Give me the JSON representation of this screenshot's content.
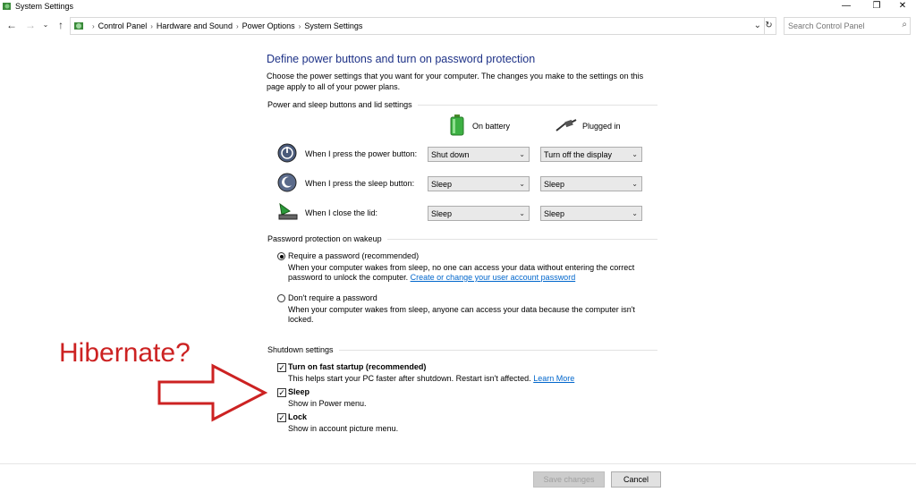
{
  "window": {
    "title": "System Settings",
    "minimize_glyph": "—",
    "restore_glyph": "❐",
    "close_glyph": "✕"
  },
  "nav": {
    "back_glyph": "←",
    "forward_glyph": "→",
    "up_glyph": "↑",
    "breadcrumbs": [
      "Control Panel",
      "Hardware and Sound",
      "Power Options",
      "System Settings"
    ],
    "dropdown_glyph": "⌄",
    "refresh_glyph": "↻",
    "search_placeholder": "Search Control Panel",
    "search_icon_glyph": "⌕"
  },
  "page": {
    "heading": "Define power buttons and turn on password protection",
    "intro": "Choose the power settings that you want for your computer. The changes you make to the settings on this page apply to all of your power plans."
  },
  "power_section": {
    "label": "Power and sleep buttons and lid settings",
    "col_battery": "On battery",
    "col_plugged": "Plugged in",
    "rows": [
      {
        "label": "When I press the power button:",
        "battery": "Shut down",
        "plugged": "Turn off the display"
      },
      {
        "label": "When I press the sleep button:",
        "battery": "Sleep",
        "plugged": "Sleep"
      },
      {
        "label": "When I close the lid:",
        "battery": "Sleep",
        "plugged": "Sleep"
      }
    ],
    "arrow_glyph": "⌄"
  },
  "password_section": {
    "label": "Password protection on wakeup",
    "require_label": "Require a password (recommended)",
    "require_desc_1": "When your computer wakes from sleep, no one can access your data without entering the correct",
    "require_desc_2": "password to unlock the computer.",
    "require_link": "Create or change your user account password",
    "no_require_label": "Don't require a password",
    "no_require_desc": "When your computer wakes from sleep, anyone can access your data because the computer isn't locked.",
    "selected": "require"
  },
  "shutdown_section": {
    "label": "Shutdown settings",
    "check_glyph": "✓",
    "fast_startup_label": "Turn on fast startup (recommended)",
    "fast_startup_desc": "This helps start your PC faster after shutdown. Restart isn't affected.",
    "learn_more": "Learn More",
    "sleep_label": "Sleep",
    "sleep_desc": "Show in Power menu.",
    "lock_label": "Lock",
    "lock_desc": "Show in account picture menu."
  },
  "footer": {
    "save_label": "Save changes",
    "cancel_label": "Cancel"
  },
  "annotation": {
    "text": "Hibernate?",
    "color": "#cc2222"
  }
}
